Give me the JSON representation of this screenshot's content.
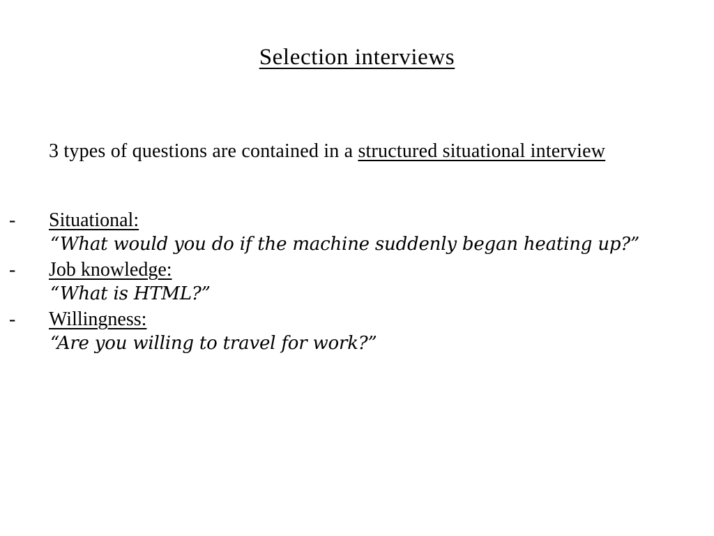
{
  "slide": {
    "title": "Selection interviews",
    "background_color": "#ffffff",
    "text_color": "#000000",
    "intro": {
      "text_before": "3 types of questions are contained in a ",
      "text_underlined": "structured situational interview"
    },
    "bullet_marker": "-",
    "bullets": [
      {
        "label": "Situational:",
        "quote": "“What would you do if the machine suddenly began heating up?”"
      },
      {
        "label": "Job knowledge:",
        "quote": "“What is HTML?”"
      },
      {
        "label": "Willingness:",
        "quote": "“Are you willing to travel for work?”"
      }
    ]
  }
}
